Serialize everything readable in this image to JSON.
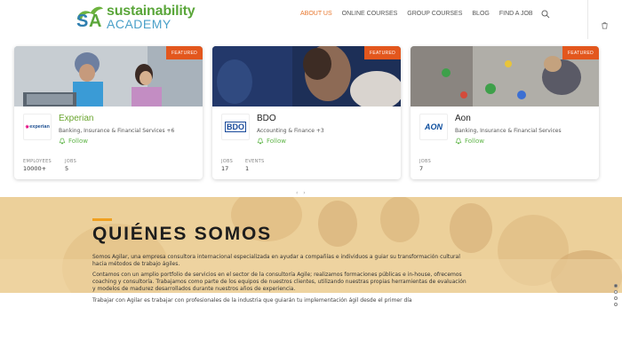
{
  "header": {
    "logo_line1": "sustainability",
    "logo_line2": "ACADEMY",
    "nav": [
      "ABOUT US",
      "ONLINE COURSES",
      "GROUP COURSES",
      "BLOG",
      "FIND A JOB"
    ],
    "active_nav": "ABOUT US",
    "search_icon": "search-icon",
    "cart_icon": "cart-icon"
  },
  "cards": [
    {
      "badge": "FEATURED",
      "name": "Experian",
      "logo_text": "experian",
      "category": "Banking, Insurance & Financial Services +6",
      "follow": "Follow",
      "stats": [
        {
          "label": "EMPLOYEES",
          "value": "10000+"
        },
        {
          "label": "JOBS",
          "value": "5"
        }
      ]
    },
    {
      "badge": "FEATURED",
      "name": "BDO",
      "logo_text": "BDO",
      "category": "Accounting & Finance +3",
      "follow": "Follow",
      "stats": [
        {
          "label": "JOBS",
          "value": "17"
        },
        {
          "label": "EVENTS",
          "value": "1"
        }
      ]
    },
    {
      "badge": "FEATURED",
      "name": "Aon",
      "logo_text": "AON",
      "category": "Banking, Insurance & Financial Services",
      "follow": "Follow",
      "stats": [
        {
          "label": "JOBS",
          "value": "7"
        }
      ]
    }
  ],
  "carousel_arrows": "‹ ›",
  "about": {
    "title": "QUIÉNES SOMOS",
    "paragraphs": [
      "Somos Agilar, una empresa consultora internacional especializada en ayudar a compañías e individuos a guiar su transformación cultural",
      "hacia métodos de trabajo ágiles.",
      "Contamos con un amplio portfolio de servicios en el sector de la consultoría Agile; realizamos formaciones públicas e in-house, ofrecemos",
      "coaching y consultoría. Trabajamos como parte de los equipos de nuestros clientes, utilizando nuestras propias herramientas de evaluación",
      "y modelos de madurez desarrollados durante nuestros años de experiencia."
    ],
    "after_text": "Trabajar con Agilar es trabajar con profesionales de la industria que guiarán tu implementación ágil desde el primer día"
  },
  "colors": {
    "accent": "#e8762c",
    "badge": "#e3571d",
    "follow": "#5fb548",
    "about_bg": "#e9c98a",
    "title_accent": "#f0a020"
  }
}
